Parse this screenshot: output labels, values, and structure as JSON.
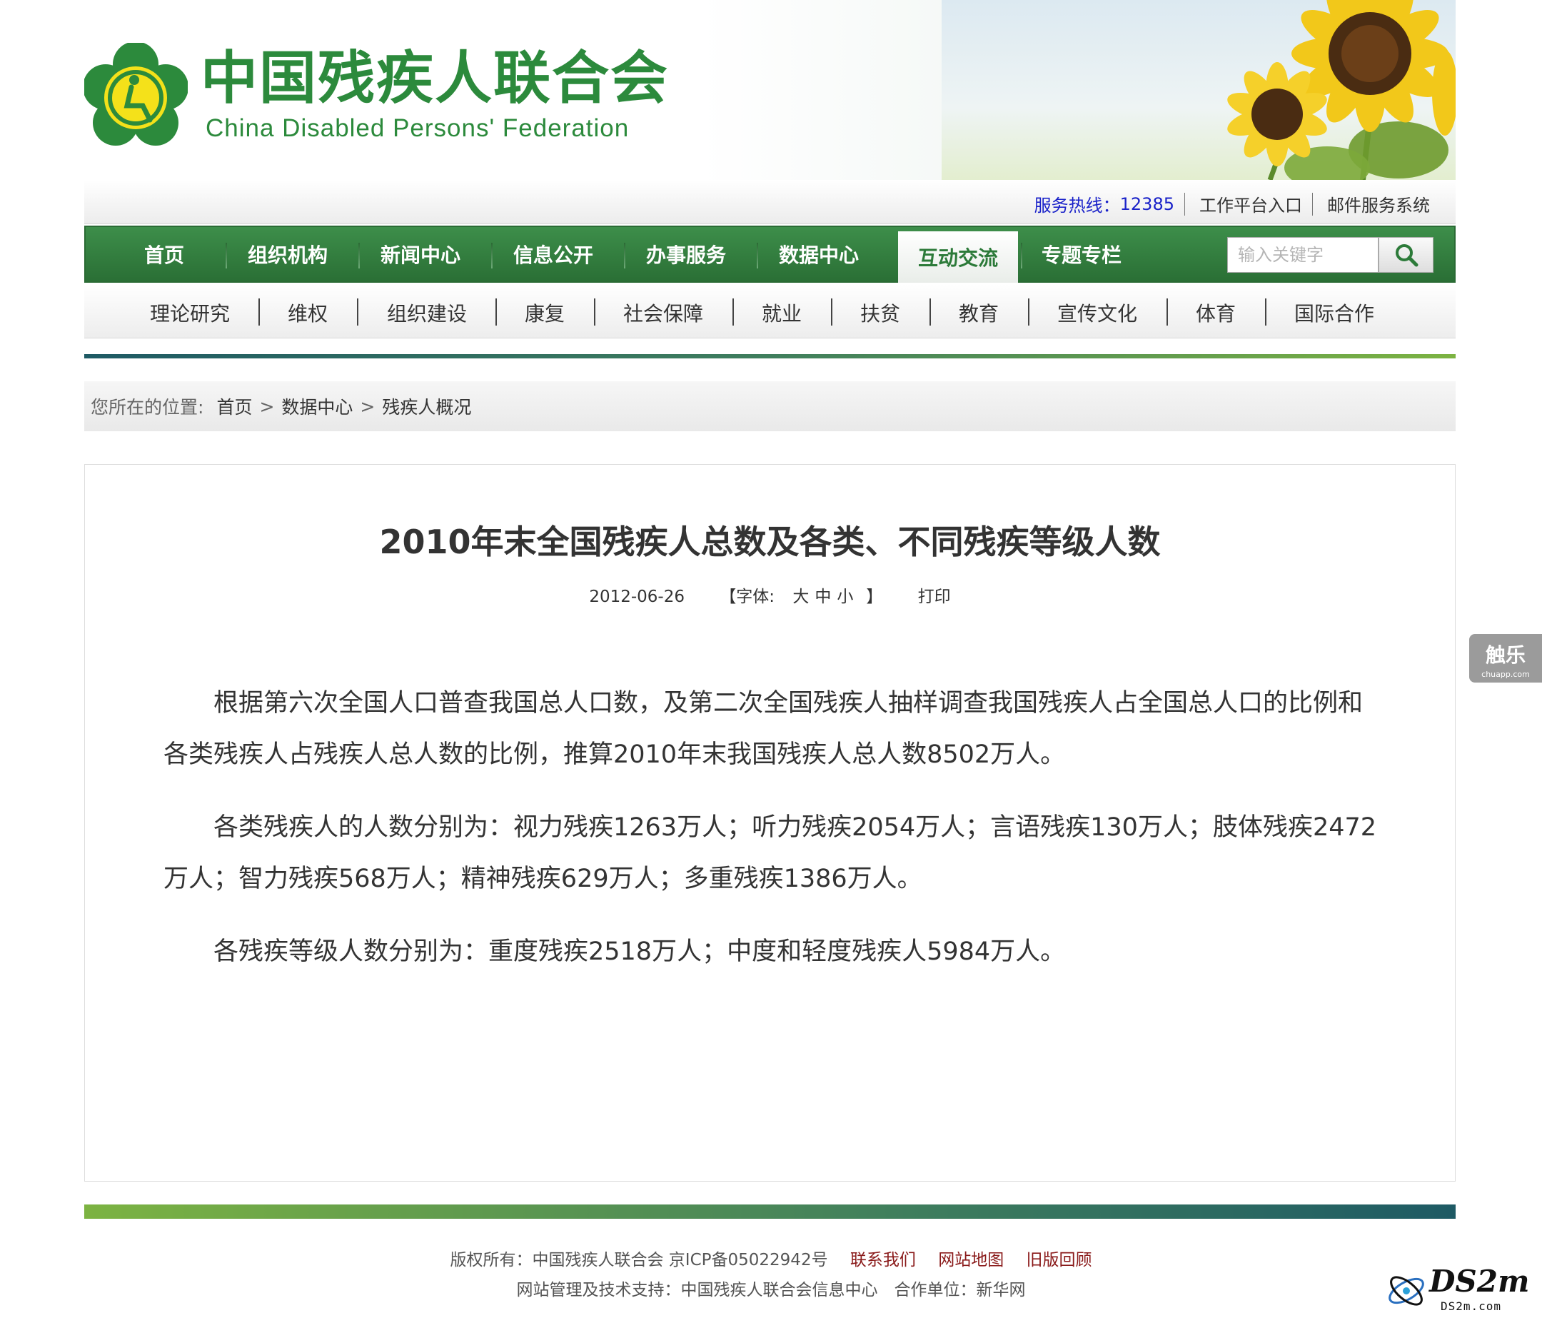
{
  "header": {
    "title_cn": "中国残疾人联合会",
    "title_en": "China Disabled Persons' Federation",
    "emblem": "cdpf-emblem-icon"
  },
  "topbar": {
    "hotline_label": "服务热线：",
    "hotline_number": "12385",
    "workbench": "工作平台入口",
    "mail": "邮件服务系统"
  },
  "mainnav": {
    "items": [
      "首页",
      "组织机构",
      "新闻中心",
      "信息公开",
      "办事服务",
      "数据中心",
      "互动交流",
      "专题专栏"
    ],
    "active_index": 6,
    "search_placeholder": "输入关键字"
  },
  "subnav": {
    "items": [
      "理论研究",
      "维权",
      "组织建设",
      "康复",
      "社会保障",
      "就业",
      "扶贫",
      "教育",
      "宣传文化",
      "体育",
      "国际合作"
    ]
  },
  "breadcrumb": {
    "prefix": "您所在的位置:",
    "items": [
      "首页",
      "数据中心",
      "残疾人概况"
    ],
    "separator": ">"
  },
  "article": {
    "title": "2010年末全国残疾人总数及各类、不同残疾等级人数",
    "date": "2012-06-26",
    "font_open": "【字体:",
    "font_large": "大",
    "font_medium": "中",
    "font_small": "小",
    "font_close": "】",
    "print": "打印",
    "paragraphs": [
      "根据第六次全国人口普查我国总人口数，及第二次全国残疾人抽样调查我国残疾人占全国总人口的比例和各类残疾人占残疾人总人数的比例，推算2010年末我国残疾人总人数8502万人。",
      "各类残疾人的人数分别为：视力残疾1263万人；听力残疾2054万人；言语残疾130万人；肢体残疾2472万人；智力残疾568万人；精神残疾629万人；多重残疾1386万人。",
      "各残疾等级人数分别为：重度残疾2518万人；中度和轻度残疾人5984万人。"
    ]
  },
  "side_badge": {
    "cn": "触乐",
    "en": "chuapp.com"
  },
  "footer": {
    "copyright": "版权所有：中国残疾人联合会 京ICP备05022942号",
    "contact": "联系我们",
    "sitemap": "网站地图",
    "old_version": "旧版回顾",
    "support": "网站管理及技术支持：中国残疾人联合会信息中心　合作单位：新华网"
  },
  "watermark": {
    "text": "DS2m",
    "sub": "DS2m.com"
  },
  "colors": {
    "brand_green": "#2c8a3c",
    "nav_green": "#347f41",
    "hotline_blue": "#1a22c9",
    "footer_link": "#8a1a1a"
  }
}
